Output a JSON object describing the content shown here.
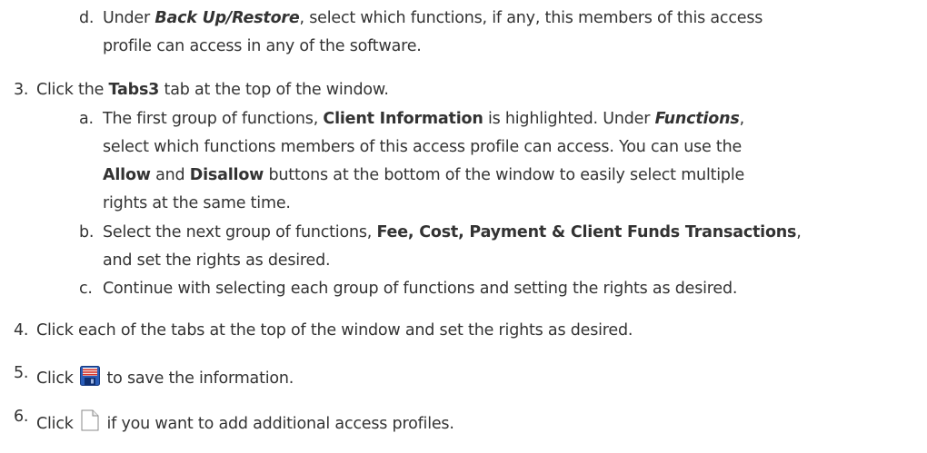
{
  "steps": {
    "d_marker": "d.",
    "d_line1_pre": "Under ",
    "d_line1_em": "Back Up/Restore",
    "d_line1_post": ", select which functions, if any, this members of this access",
    "d_line2": "profile can access in any of the software.",
    "s3_marker": "3.",
    "s3_pre": "Click the ",
    "s3_bold": "Tabs3",
    "s3_post": " tab at the top of the window.",
    "a_marker": "a.",
    "a_line1_pre": "The first group of functions, ",
    "a_line1_bold": "Client Information",
    "a_line1_mid": " is highlighted. Under ",
    "a_line1_em": "Functions",
    "a_line1_post": ",",
    "a_line2": "select which functions members of this access profile can access. You can use the",
    "a_line3_b1": "Allow",
    "a_line3_mid": " and ",
    "a_line3_b2": "Disallow",
    "a_line3_post": " buttons at the bottom of the window to easily select multiple",
    "a_line4": "rights at the same time.",
    "b_marker": "b.",
    "b_line1_pre": "Select the next group of functions, ",
    "b_line1_bold": "Fee, Cost, Payment & Client Funds Transactions",
    "b_line1_post": ",",
    "b_line2": "and set the rights as desired.",
    "c_marker": "c.",
    "c_line1": "Continue with selecting each group of functions and setting the rights as desired.",
    "s4_marker": "4.",
    "s4_text": "Click each of the tabs at the top of the window and set the rights as desired.",
    "s5_marker": "5.",
    "s5_pre": "Click",
    "s5_post": "to save the information.",
    "s6_marker": "6.",
    "s6_pre": "Click",
    "s6_post": "if you want to add additional access profiles."
  },
  "icons": {
    "save": "save-icon",
    "new_document": "new-document-icon"
  },
  "colors": {
    "text": "#333333",
    "save_icon_blue": "#1f4fa6",
    "save_icon_red": "#d9342b"
  }
}
